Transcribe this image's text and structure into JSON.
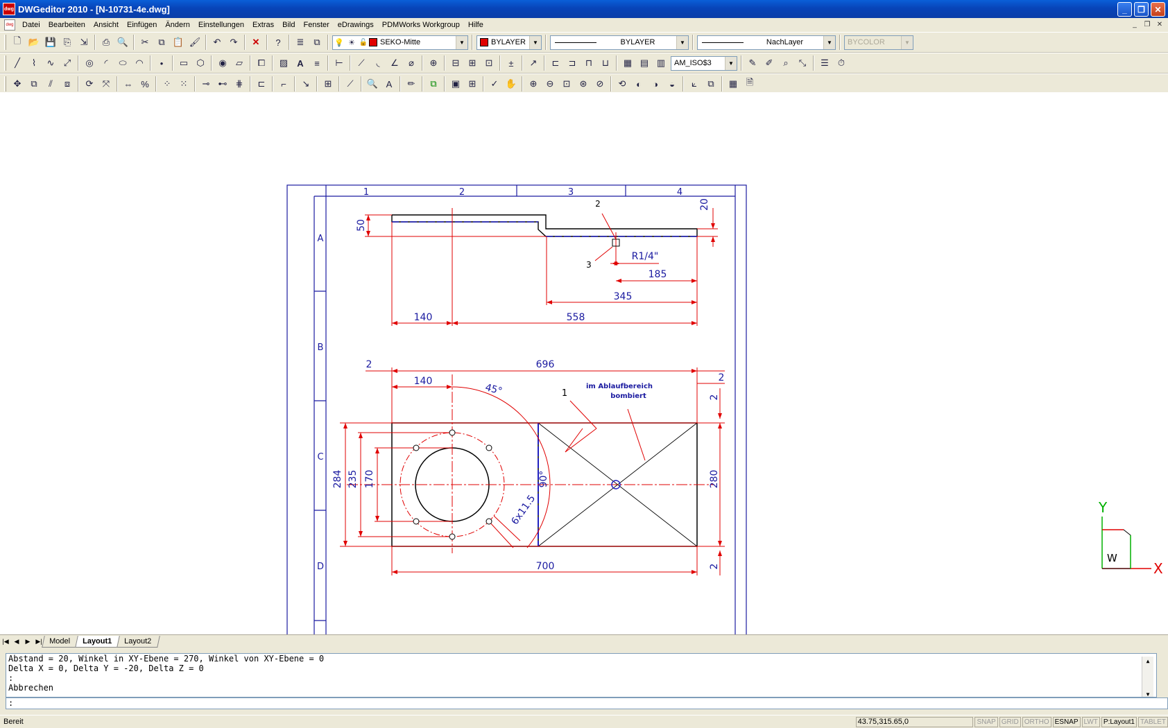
{
  "window": {
    "title": "DWGeditor 2010 - [N-10731-4e.dwg]"
  },
  "menu": [
    "Datei",
    "Bearbeiten",
    "Ansicht",
    "Einfügen",
    "Ändern",
    "Einstellungen",
    "Extras",
    "Bild",
    "Fenster",
    "eDrawings",
    "PDMWorks Workgroup",
    "Hilfe"
  ],
  "toolbar": {
    "layer": "SEKO-Mitte",
    "color": "BYLAYER",
    "linetype": "BYLAYER",
    "lineweight": "NachLayer",
    "plotstyle": "BYCOLOR",
    "dimstyle": "AM_ISO$3",
    "layer_color": "#e00000"
  },
  "drawing": {
    "border_cols": [
      "1",
      "2",
      "3",
      "4"
    ],
    "border_rows": [
      "A",
      "B",
      "C",
      "D"
    ],
    "dims_top": {
      "d50": "50",
      "d20": "20",
      "d2": "2",
      "d3": "3",
      "thread": "R1/4\"",
      "d185": "185",
      "d345": "345",
      "d140": "140",
      "d558": "558"
    },
    "dims_plan": {
      "d2_left": "2",
      "d696": "696",
      "d2_right": "2",
      "d140": "140",
      "angle45": "45°",
      "label1": "1",
      "note1": "im Ablaufbereich",
      "note2": "bombiert",
      "d2_v_top": "2",
      "d284": "284",
      "d235": "235",
      "d170": "170",
      "angle90": "90°",
      "holes": "6x11.5",
      "d280": "280",
      "d700": "700",
      "d2_v_bottom": "2"
    },
    "ucs": {
      "y": "Y",
      "x": "X",
      "w": "W"
    }
  },
  "tabs": [
    "Model",
    "Layout1",
    "Layout2"
  ],
  "active_tab": "Layout1",
  "command": {
    "history": [
      "Abstand = 20, Winkel in XY-Ebene = 270, Winkel von XY-Ebene = 0",
      "Delta X = 0,  Delta Y = -20,  Delta Z = 0",
      ":",
      "Abbrechen"
    ],
    "prompt": ":"
  },
  "status": {
    "ready": "Bereit",
    "coords": "43.75,315.65,0",
    "toggles": [
      {
        "label": "SNAP",
        "on": false
      },
      {
        "label": "GRID",
        "on": false
      },
      {
        "label": "ORTHO",
        "on": false
      },
      {
        "label": "ESNAP",
        "on": true
      },
      {
        "label": "LWT",
        "on": false
      },
      {
        "label": "P:Layout1",
        "on": true
      },
      {
        "label": "TABLET",
        "on": false
      }
    ]
  }
}
